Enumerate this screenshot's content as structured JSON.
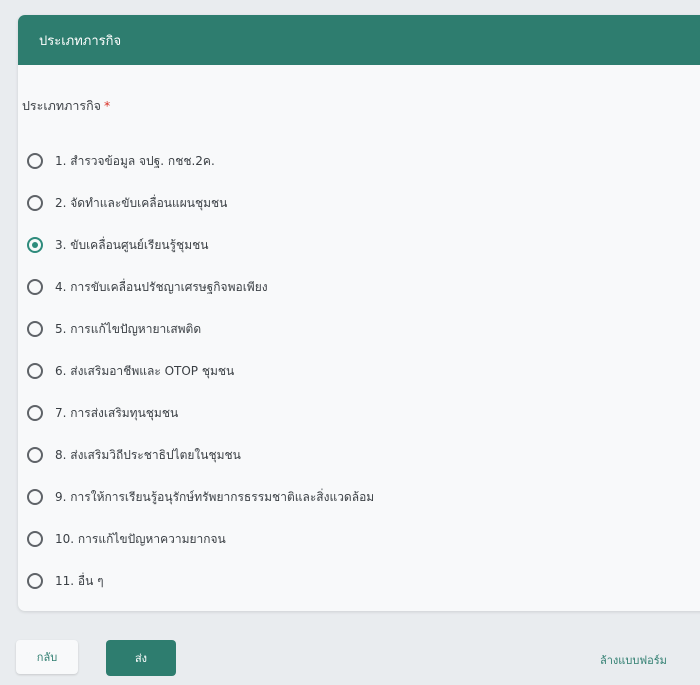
{
  "form": {
    "section_title": "ประเภทภารกิจ",
    "question": "ประเภทภารกิจ",
    "required_mark": "*",
    "selected_index": 2,
    "options": [
      "1. สำรวจข้อมูล จปฐ. กชช.2ค.",
      "2. จัดทำและขับเคลื่อนแผนชุมชน",
      "3. ขับเคลื่อนศูนย์เรียนรู้ชุมชน",
      "4. การขับเคลื่อนปรัชญาเศรษฐกิจพอเพียง",
      "5. การแก้ไขปัญหายาเสพติด",
      "6. ส่งเสริมอาชีพและ OTOP ชุมชน",
      "7. การส่งเสริมทุนชุมชน",
      "8. ส่งเสริมวิถีประชาธิปไตยในชุมชน",
      "9. การให้การเรียนรู้อนุรักษ์ทรัพยากรธรรมชาติและสิ่งแวดล้อม",
      "10. การแก้ไขปัญหาความยากจน",
      "11. อื่น ๆ"
    ]
  },
  "footer": {
    "back_label": "กลับ",
    "submit_label": "ส่ง",
    "clear_label": "ล้างแบบฟอร์ม"
  },
  "colors": {
    "accent": "#2e7d6f",
    "radio_selected": "#2e8b7c",
    "required": "#d93025"
  }
}
